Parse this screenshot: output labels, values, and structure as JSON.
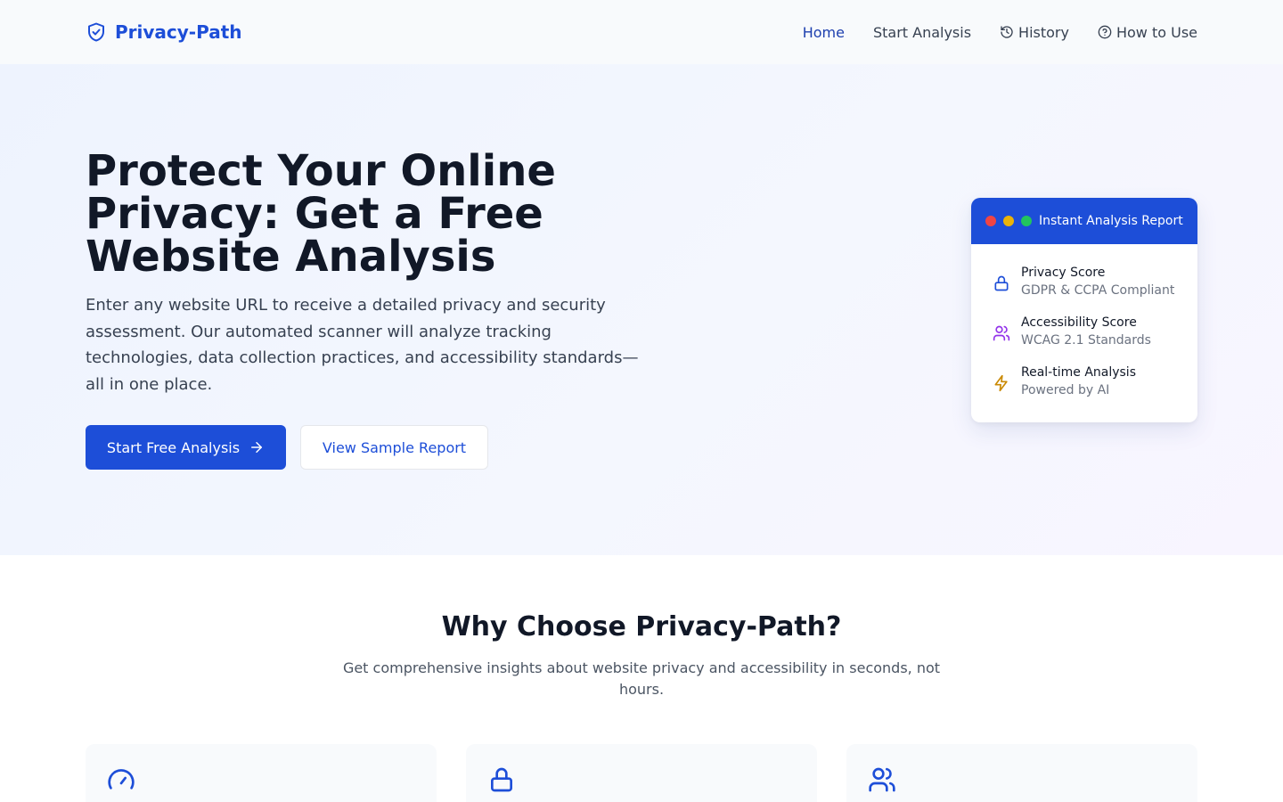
{
  "brand": {
    "name": "Privacy-Path",
    "icon": "shield-check-icon",
    "color": "#1d4ed8"
  },
  "nav": {
    "links": [
      {
        "label": "Home",
        "active": true
      },
      {
        "label": "Start Analysis"
      },
      {
        "label": "History",
        "icon": "history-icon"
      },
      {
        "label": "How to Use",
        "icon": "help-circle-icon"
      }
    ]
  },
  "hero": {
    "title": "Protect Your Online Privacy: Get a Free Website Analysis",
    "description": "Enter any website URL to receive a detailed privacy and security assessment. Our automated scanner will analyze tracking technologies, data collection practices, and accessibility standards—all in one place.",
    "primary_button": "Start Free Analysis",
    "secondary_button": "View Sample Report"
  },
  "report_card": {
    "title": "Instant Analysis Report",
    "window_dots": [
      "#ef4444",
      "#eab308",
      "#22c55e"
    ],
    "items": [
      {
        "title": "Privacy Score",
        "subtitle": "GDPR & CCPA Compliant",
        "icon": "lock-icon",
        "color": "#1d4ed8"
      },
      {
        "title": "Accessibility Score",
        "subtitle": "WCAG 2.1 Standards",
        "icon": "users-icon",
        "color": "#9333ea"
      },
      {
        "title": "Real-time Analysis",
        "subtitle": "Powered by AI",
        "icon": "lightning-icon",
        "color": "#ca8a04"
      }
    ]
  },
  "why": {
    "title": "Why Choose Privacy-Path?",
    "subtitle": "Get comprehensive insights about website privacy and accessibility in seconds, not hours.",
    "features": [
      {
        "icon": "gauge-icon"
      },
      {
        "icon": "lock-icon"
      },
      {
        "icon": "users-icon"
      }
    ]
  }
}
